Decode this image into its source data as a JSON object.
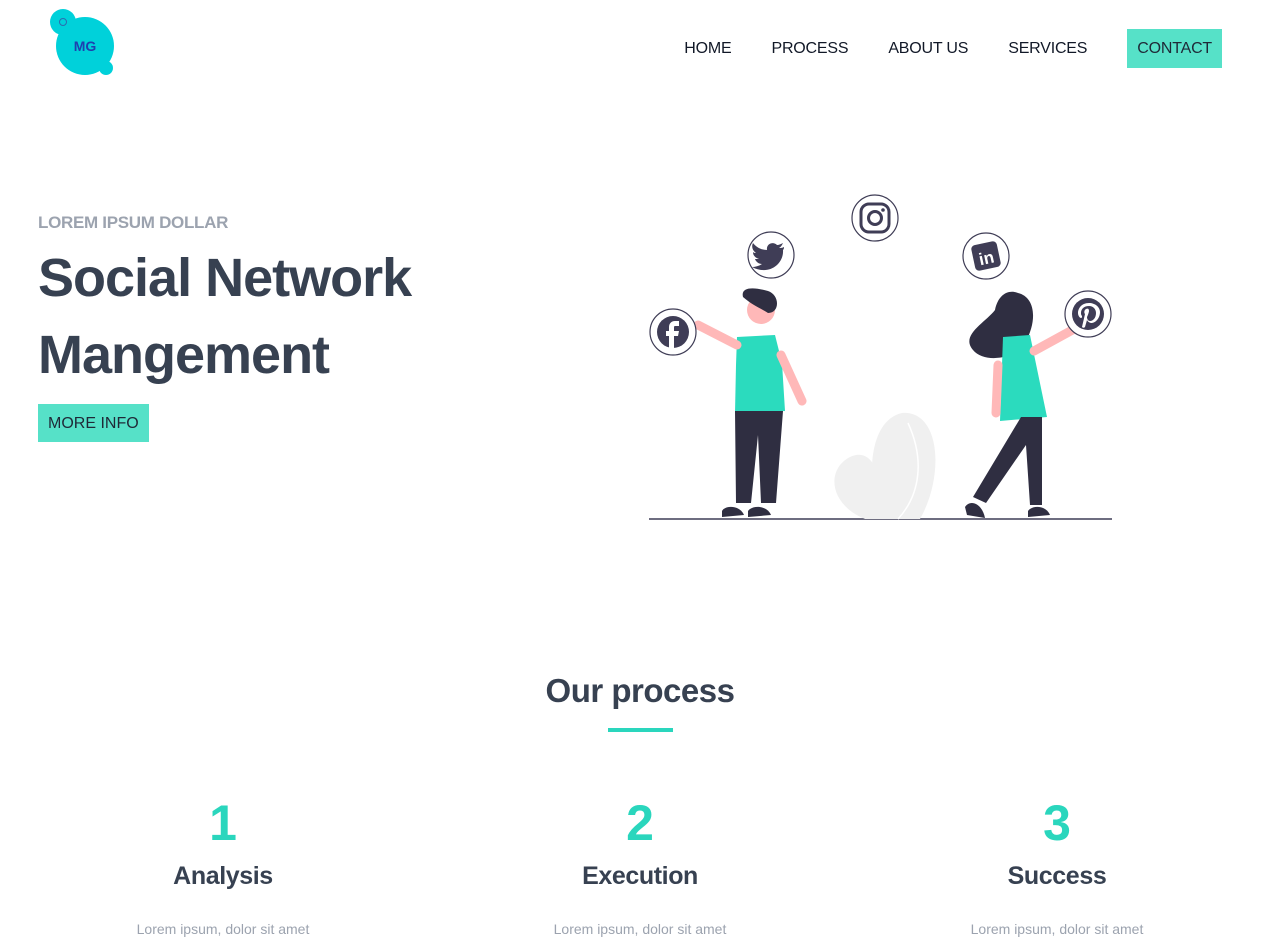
{
  "brand": {
    "logo_text": "MG",
    "accent": "#56e1c8",
    "logo_color": "#00d1da"
  },
  "nav": {
    "items": [
      "HOME",
      "PROCESS",
      "ABOUT US",
      "SERVICES"
    ],
    "cta": "CONTACT"
  },
  "hero": {
    "eyebrow": "LOREM IPSUM DOLLAR",
    "title_line1": "Social Network",
    "title_line2": "Mangement",
    "button": "MORE INFO",
    "social_icons": [
      "facebook-icon",
      "twitter-icon",
      "instagram-icon",
      "linkedin-icon",
      "pinterest-icon"
    ]
  },
  "process": {
    "title": "Our process",
    "steps": [
      {
        "number": "1",
        "title": "Analysis",
        "text": "Lorem ipsum, dolor sit amet"
      },
      {
        "number": "2",
        "title": "Execution",
        "text": "Lorem ipsum, dolor sit amet"
      },
      {
        "number": "3",
        "title": "Success",
        "text": "Lorem ipsum, dolor sit amet"
      }
    ]
  }
}
